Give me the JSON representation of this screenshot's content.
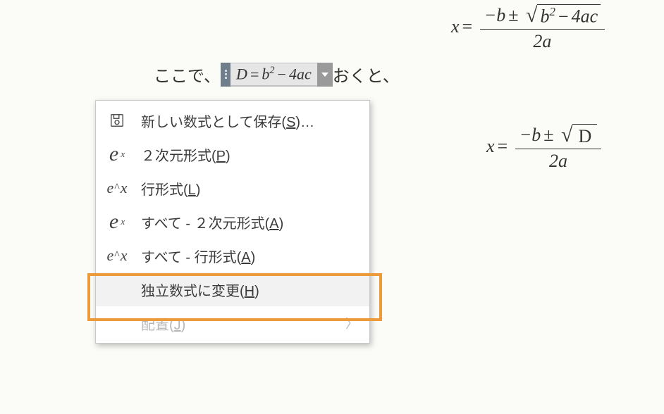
{
  "equations": {
    "line_text_before": "ここで、",
    "line_text_after": "おくと、",
    "inline_formula": "D = b² − 4ac",
    "quad_full": {
      "lhs": "x",
      "num": "−b ± √(b² − 4ac)",
      "den": "2a"
    },
    "quad_d": {
      "lhs": "x",
      "num": "−b ± √D",
      "den": "2a"
    }
  },
  "menu": {
    "save": {
      "label_pre": "新しい数式として保存(",
      "key": "S",
      "label_post": ")…"
    },
    "prof2d": {
      "label_pre": "２次元形式(",
      "key": "P",
      "label_post": ")"
    },
    "linear": {
      "label_pre": "行形式(",
      "key": "L",
      "label_post": ")"
    },
    "all2d": {
      "label_pre": "すべて - ２次元形式(",
      "key": "A",
      "label_post": ")"
    },
    "allLinear": {
      "label_pre": "すべて - 行形式(",
      "key": "A",
      "label_post": ")"
    },
    "changeDisp": {
      "label_pre": "独立数式に変更(",
      "key": "H",
      "label_post": ")"
    },
    "justify": {
      "label_pre": "配置(",
      "key": "J",
      "label_post": ")"
    }
  }
}
